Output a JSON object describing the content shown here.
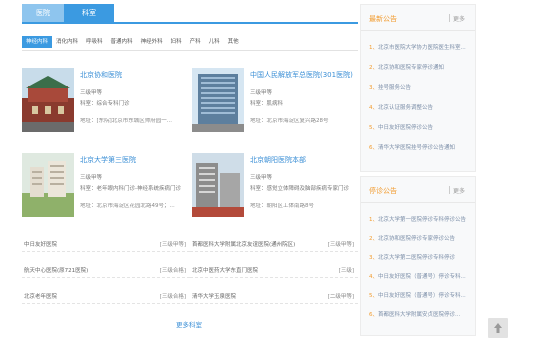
{
  "top_tabs": [
    "医院",
    "科室"
  ],
  "depts": [
    "神经内科",
    "消化内科",
    "呼吸科",
    "普通内科",
    "神经外科",
    "妇科",
    "产科",
    "儿科",
    "其他"
  ],
  "cards": [
    {
      "name": "北京协和医院",
      "grade": "三级甲等",
      "specialty": "科室：综合专科门诊",
      "addr": "地址：[东院]北京市东城区帅府园一..."
    },
    {
      "name": "中国人民解放军总医院(301医院)",
      "grade": "三级甲等",
      "specialty": "科室：肌病科",
      "addr": "地址：北京市海淀区复兴路28号"
    },
    {
      "name": "北京大学第三医院",
      "grade": "三级甲等",
      "specialty": "科室：老年眼内科门诊-神经系统疾病门诊",
      "addr": "地址：北京市海淀区花园北路49号；..."
    },
    {
      "name": "北京朝阳医院本部",
      "grade": "三级甲等",
      "specialty": "科室：感觉立体障碍及脑部疾病专家门诊",
      "addr": "地址：朝阳区工体南路8号"
    }
  ],
  "list_left": [
    {
      "name": "中日友好医院",
      "grade": "[三级甲等]"
    },
    {
      "name": "航天中心医院(原721医院)",
      "grade": "[三级合格]"
    },
    {
      "name": "北京老年医院",
      "grade": "[三级合格]"
    }
  ],
  "list_right": [
    {
      "name": "首都医科大学附属北京友谊医院(通州院区)",
      "grade": "[三级甲等]"
    },
    {
      "name": "北京中医药大学东直门医院",
      "grade": "[三级]"
    },
    {
      "name": "清华大学玉泉医院",
      "grade": "[二级甲等]"
    }
  ],
  "more_link": "更多科室",
  "notice_panel": {
    "title": "最新公告",
    "more": "更多",
    "items": [
      "北京市医院大学协力医院医生科室...",
      "北京协和医院专家停诊通知",
      "挂号服务公告",
      "北京认证服务调整公告",
      "中日友好医院停诊公告",
      "清华大学医院挂号停诊公告通知"
    ]
  },
  "stop_panel": {
    "title": "停诊公告",
    "more": "更多",
    "items": [
      "北京大学第一医院停诊专科停诊公告",
      "北京协和医院停诊专家停诊公告",
      "北京大学第二医院停诊专科停诊",
      "中日友好医院（普通号）停诊专科...",
      "中日友好医院（普通号）停诊专科...",
      "首都医科大学附属安贞医院停诊..."
    ]
  }
}
